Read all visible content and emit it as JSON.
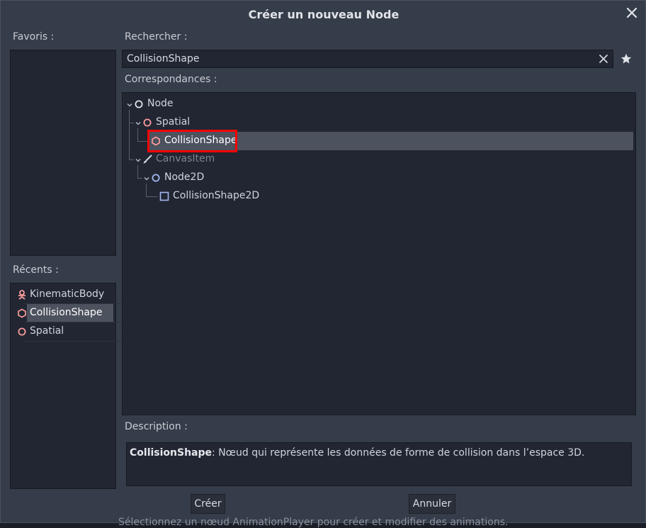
{
  "dialog": {
    "title": "Créer un nouveau Node"
  },
  "favorites": {
    "label": "Favoris :"
  },
  "recents": {
    "label": "Récents :",
    "items": [
      {
        "label": "KinematicBody",
        "icon": "kinematic-body-icon"
      },
      {
        "label": "CollisionShape",
        "icon": "collision-shape-icon",
        "selected": true
      },
      {
        "label": "Spatial",
        "icon": "spatial-icon"
      }
    ]
  },
  "search": {
    "label": "Rechercher :",
    "value": "CollisionShape"
  },
  "matches": {
    "label": "Correspondances :",
    "tree": [
      {
        "label": "Node",
        "depth": 0
      },
      {
        "label": "Spatial",
        "depth": 1
      },
      {
        "label": "CollisionShape",
        "depth": 2,
        "selected": true
      },
      {
        "label": "CanvasItem",
        "depth": 1,
        "dimmed": true
      },
      {
        "label": "Node2D",
        "depth": 2
      },
      {
        "label": "CollisionShape2D",
        "depth": 3
      }
    ]
  },
  "description": {
    "label": "Description :",
    "name": "CollisionShape",
    "text": ": Nœud qui représente les données de forme de collision dans l’espace 3D."
  },
  "buttons": {
    "create": "Créer",
    "cancel": "Annuler"
  },
  "footer": {
    "text": "Sélectionnez un nœud AnimationPlayer pour créer et modifier des animations."
  },
  "colors": {
    "spatial": "#fc9c9c",
    "node2d": "#a5b7f3",
    "dialog_bg": "#363d4a",
    "panel_bg": "#212632",
    "selection": "#4c525e",
    "highlight": "#ff0000"
  }
}
